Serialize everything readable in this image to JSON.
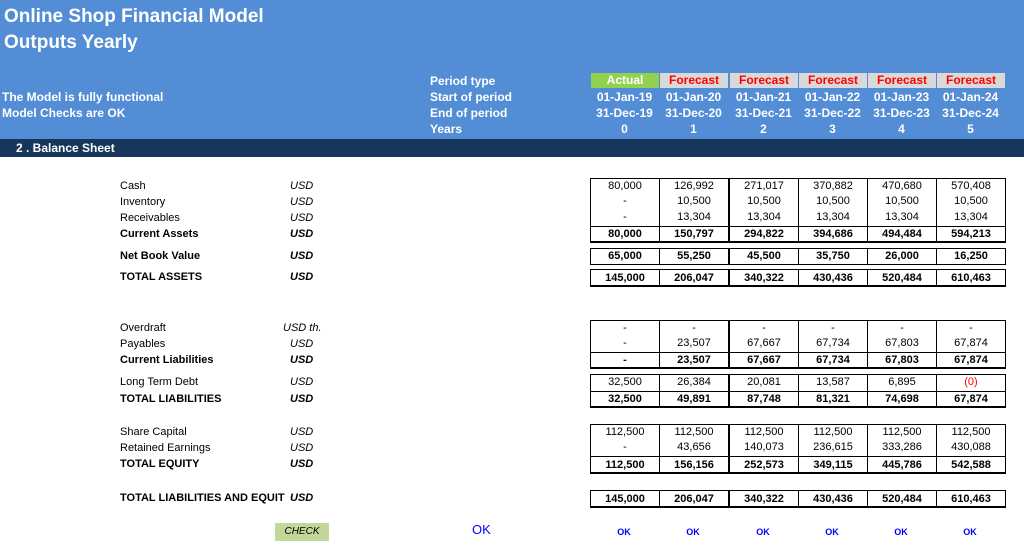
{
  "header": {
    "title_line1": "Online Shop Financial Model",
    "title_line2": "Outputs Yearly",
    "status1": "The Model is fully functional",
    "status2": "Model Checks are OK",
    "labels": {
      "period_type": "Period type",
      "start": "Start of period",
      "end": "End of period",
      "years": "Years"
    },
    "columns": [
      {
        "type": "Actual",
        "start": "01-Jan-19",
        "end": "31-Dec-19",
        "year": "0"
      },
      {
        "type": "Forecast",
        "start": "01-Jan-20",
        "end": "31-Dec-20",
        "year": "1"
      },
      {
        "type": "Forecast",
        "start": "01-Jan-21",
        "end": "31-Dec-21",
        "year": "2"
      },
      {
        "type": "Forecast",
        "start": "01-Jan-22",
        "end": "31-Dec-22",
        "year": "3"
      },
      {
        "type": "Forecast",
        "start": "01-Jan-23",
        "end": "31-Dec-23",
        "year": "4"
      },
      {
        "type": "Forecast",
        "start": "01-Jan-24",
        "end": "31-Dec-24",
        "year": "5"
      }
    ]
  },
  "section": {
    "title": "2 . Balance Sheet"
  },
  "rows": [
    {
      "key": "cash",
      "label": "Cash",
      "unit": "USD",
      "values": [
        "80,000",
        "126,992",
        "271,017",
        "370,882",
        "470,680",
        "570,408"
      ]
    },
    {
      "key": "inventory",
      "label": "Inventory",
      "unit": "USD",
      "values": [
        "-",
        "10,500",
        "10,500",
        "10,500",
        "10,500",
        "10,500"
      ]
    },
    {
      "key": "receivables",
      "label": "Receivables",
      "unit": "USD",
      "values": [
        "-",
        "13,304",
        "13,304",
        "13,304",
        "13,304",
        "13,304"
      ]
    },
    {
      "key": "current_assets",
      "label": "Current Assets",
      "unit": "USD",
      "values": [
        "80,000",
        "150,797",
        "294,822",
        "394,686",
        "494,484",
        "594,213"
      ]
    },
    {
      "key": "nbv",
      "label": "Net Book Value",
      "unit": "USD",
      "values": [
        "65,000",
        "55,250",
        "45,500",
        "35,750",
        "26,000",
        "16,250"
      ]
    },
    {
      "key": "total_assets",
      "label": "TOTAL ASSETS",
      "unit": "USD",
      "values": [
        "145,000",
        "206,047",
        "340,322",
        "430,436",
        "520,484",
        "610,463"
      ]
    },
    {
      "key": "overdraft",
      "label": "Overdraft",
      "unit": "USD th.",
      "values": [
        "-",
        "-",
        "-",
        "-",
        "-",
        "-"
      ]
    },
    {
      "key": "payables",
      "label": "Payables",
      "unit": "USD",
      "values": [
        "-",
        "23,507",
        "67,667",
        "67,734",
        "67,803",
        "67,874"
      ]
    },
    {
      "key": "current_liab",
      "label": "Current Liabilities",
      "unit": "USD",
      "values": [
        "-",
        "23,507",
        "67,667",
        "67,734",
        "67,803",
        "67,874"
      ]
    },
    {
      "key": "ltd",
      "label": "Long Term Debt",
      "unit": "USD",
      "values": [
        "32,500",
        "26,384",
        "20,081",
        "13,587",
        "6,895",
        "(0)"
      ]
    },
    {
      "key": "total_liab",
      "label": "TOTAL LIABILITIES",
      "unit": "USD",
      "values": [
        "32,500",
        "49,891",
        "87,748",
        "81,321",
        "74,698",
        "67,874"
      ]
    },
    {
      "key": "share_cap",
      "label": "Share Capital",
      "unit": "USD",
      "values": [
        "112,500",
        "112,500",
        "112,500",
        "112,500",
        "112,500",
        "112,500"
      ]
    },
    {
      "key": "retained",
      "label": "Retained Earnings",
      "unit": "USD",
      "values": [
        "-",
        "43,656",
        "140,073",
        "236,615",
        "333,286",
        "430,088"
      ]
    },
    {
      "key": "total_equity",
      "label": "TOTAL EQUITY",
      "unit": "USD",
      "values": [
        "112,500",
        "156,156",
        "252,573",
        "349,115",
        "445,786",
        "542,588"
      ]
    },
    {
      "key": "total_le",
      "label": "TOTAL LIABILITIES AND EQUIT",
      "unit": "USD",
      "values": [
        "145,000",
        "206,047",
        "340,322",
        "430,436",
        "520,484",
        "610,463"
      ]
    }
  ],
  "check": {
    "label": "CHECK",
    "overall": "OK",
    "values": [
      "OK",
      "OK",
      "OK",
      "OK",
      "OK",
      "OK"
    ]
  },
  "colors": {
    "header_bg": "#538dd5",
    "section_bg": "#16365c",
    "actual_bg": "#92d050",
    "forecast_bg": "#d9d9d9",
    "forecast_text": "#ff0000",
    "check_bg": "#c4d79b",
    "ok_text": "#0000ff"
  }
}
